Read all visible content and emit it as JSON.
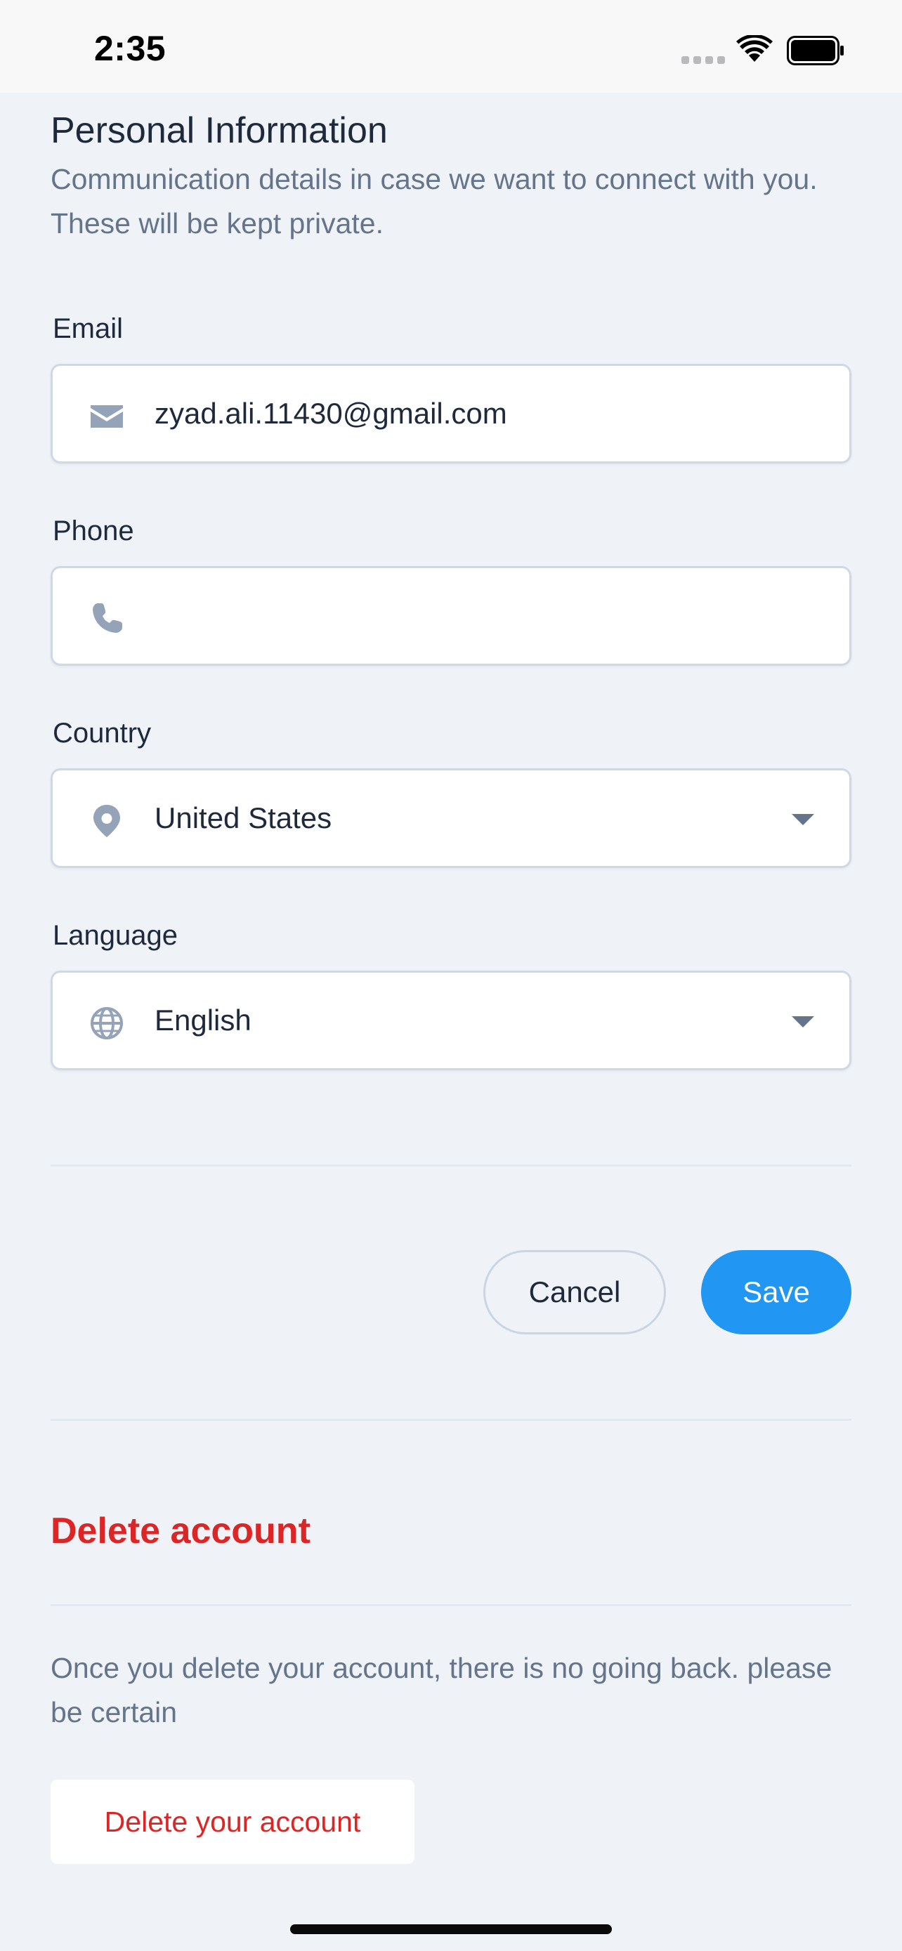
{
  "status_bar": {
    "time": "2:35"
  },
  "personal_info": {
    "title": "Personal Information",
    "subtitle": "Communication details in case we want to connect with you. These will be kept private."
  },
  "email": {
    "label": "Email",
    "value": "zyad.ali.11430@gmail.com",
    "icon": "envelope-icon"
  },
  "phone": {
    "label": "Phone",
    "value": "",
    "icon": "phone-icon"
  },
  "country": {
    "label": "Country",
    "value": "United States",
    "icon": "map-pin-icon"
  },
  "language": {
    "label": "Language",
    "value": "English",
    "icon": "globe-icon"
  },
  "actions": {
    "cancel_label": "Cancel",
    "save_label": "Save"
  },
  "delete_section": {
    "title": "Delete account",
    "description": "Once you delete your account, there is no going back. please be certain",
    "button_label": "Delete your account"
  },
  "colors": {
    "background": "#eff3f8",
    "primary": "#2196f3",
    "danger": "#dc2626",
    "muted_text": "#64748b",
    "icon": "#94a3b8"
  }
}
